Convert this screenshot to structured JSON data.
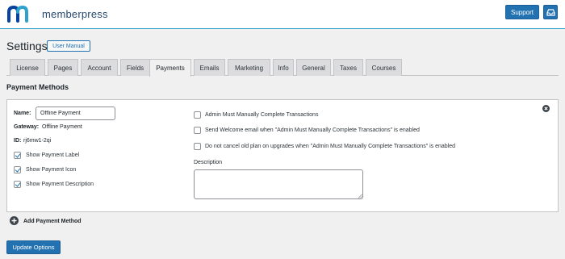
{
  "header": {
    "logo_text": "memberpress",
    "support_label": "Support",
    "inbox_icon": "inbox-icon",
    "brand_color": "#2271b1"
  },
  "page": {
    "title": "Settings",
    "user_manual_label": "User Manual"
  },
  "tabs": [
    {
      "label": "License",
      "active": false
    },
    {
      "label": "Pages",
      "active": false
    },
    {
      "label": "Account",
      "active": false
    },
    {
      "label": "Fields",
      "active": false
    },
    {
      "label": "Payments",
      "active": true
    },
    {
      "label": "Emails",
      "active": false
    },
    {
      "label": "Marketing",
      "active": false
    },
    {
      "label": "Info",
      "active": false
    },
    {
      "label": "General",
      "active": false
    },
    {
      "label": "Taxes",
      "active": false
    },
    {
      "label": "Courses",
      "active": false
    }
  ],
  "section": {
    "title": "Payment Methods"
  },
  "method": {
    "name_label": "Name:",
    "name_value": "Offline Payment",
    "gateway_label": "Gateway:",
    "gateway_value": "Offline Payment",
    "id_label": "ID:",
    "id_value": "rj6mw1-2qi",
    "left_options": [
      {
        "label": "Show Payment Label",
        "checked": true
      },
      {
        "label": "Show Payment Icon",
        "checked": true
      },
      {
        "label": "Show Payment Description",
        "checked": true
      }
    ],
    "right_options": [
      {
        "label": "Admin Must Manually Complete Transactions",
        "checked": false
      },
      {
        "label": "Send Welcome email when \"Admin Must Manually Complete Transactions\" is enabled",
        "checked": false
      },
      {
        "label": "Do not cancel old plan on upgrades when \"Admin Must Manually Complete Transactions\" is enabled",
        "checked": false
      }
    ],
    "description_label": "Description",
    "description_value": ""
  },
  "add_method_label": "Add Payment Method",
  "update_label": "Update Options"
}
